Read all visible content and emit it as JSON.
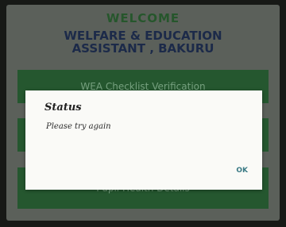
{
  "header": {
    "welcome": "WELCOME",
    "org_line1": "WELFARE & EDUCATION",
    "org_line2": "ASSISTANT , BAKURU"
  },
  "menu": {
    "items": [
      {
        "label": "WEA Checklist Verification"
      },
      {
        "label": ""
      },
      {
        "label": "Pupil Health Details"
      }
    ]
  },
  "dialog": {
    "title": "Status",
    "message": "Please try again",
    "ok_label": "OK"
  },
  "colors": {
    "accent_green": "#2e6b3a",
    "title_navy": "#23345a",
    "ok_teal": "#3a7a85"
  }
}
